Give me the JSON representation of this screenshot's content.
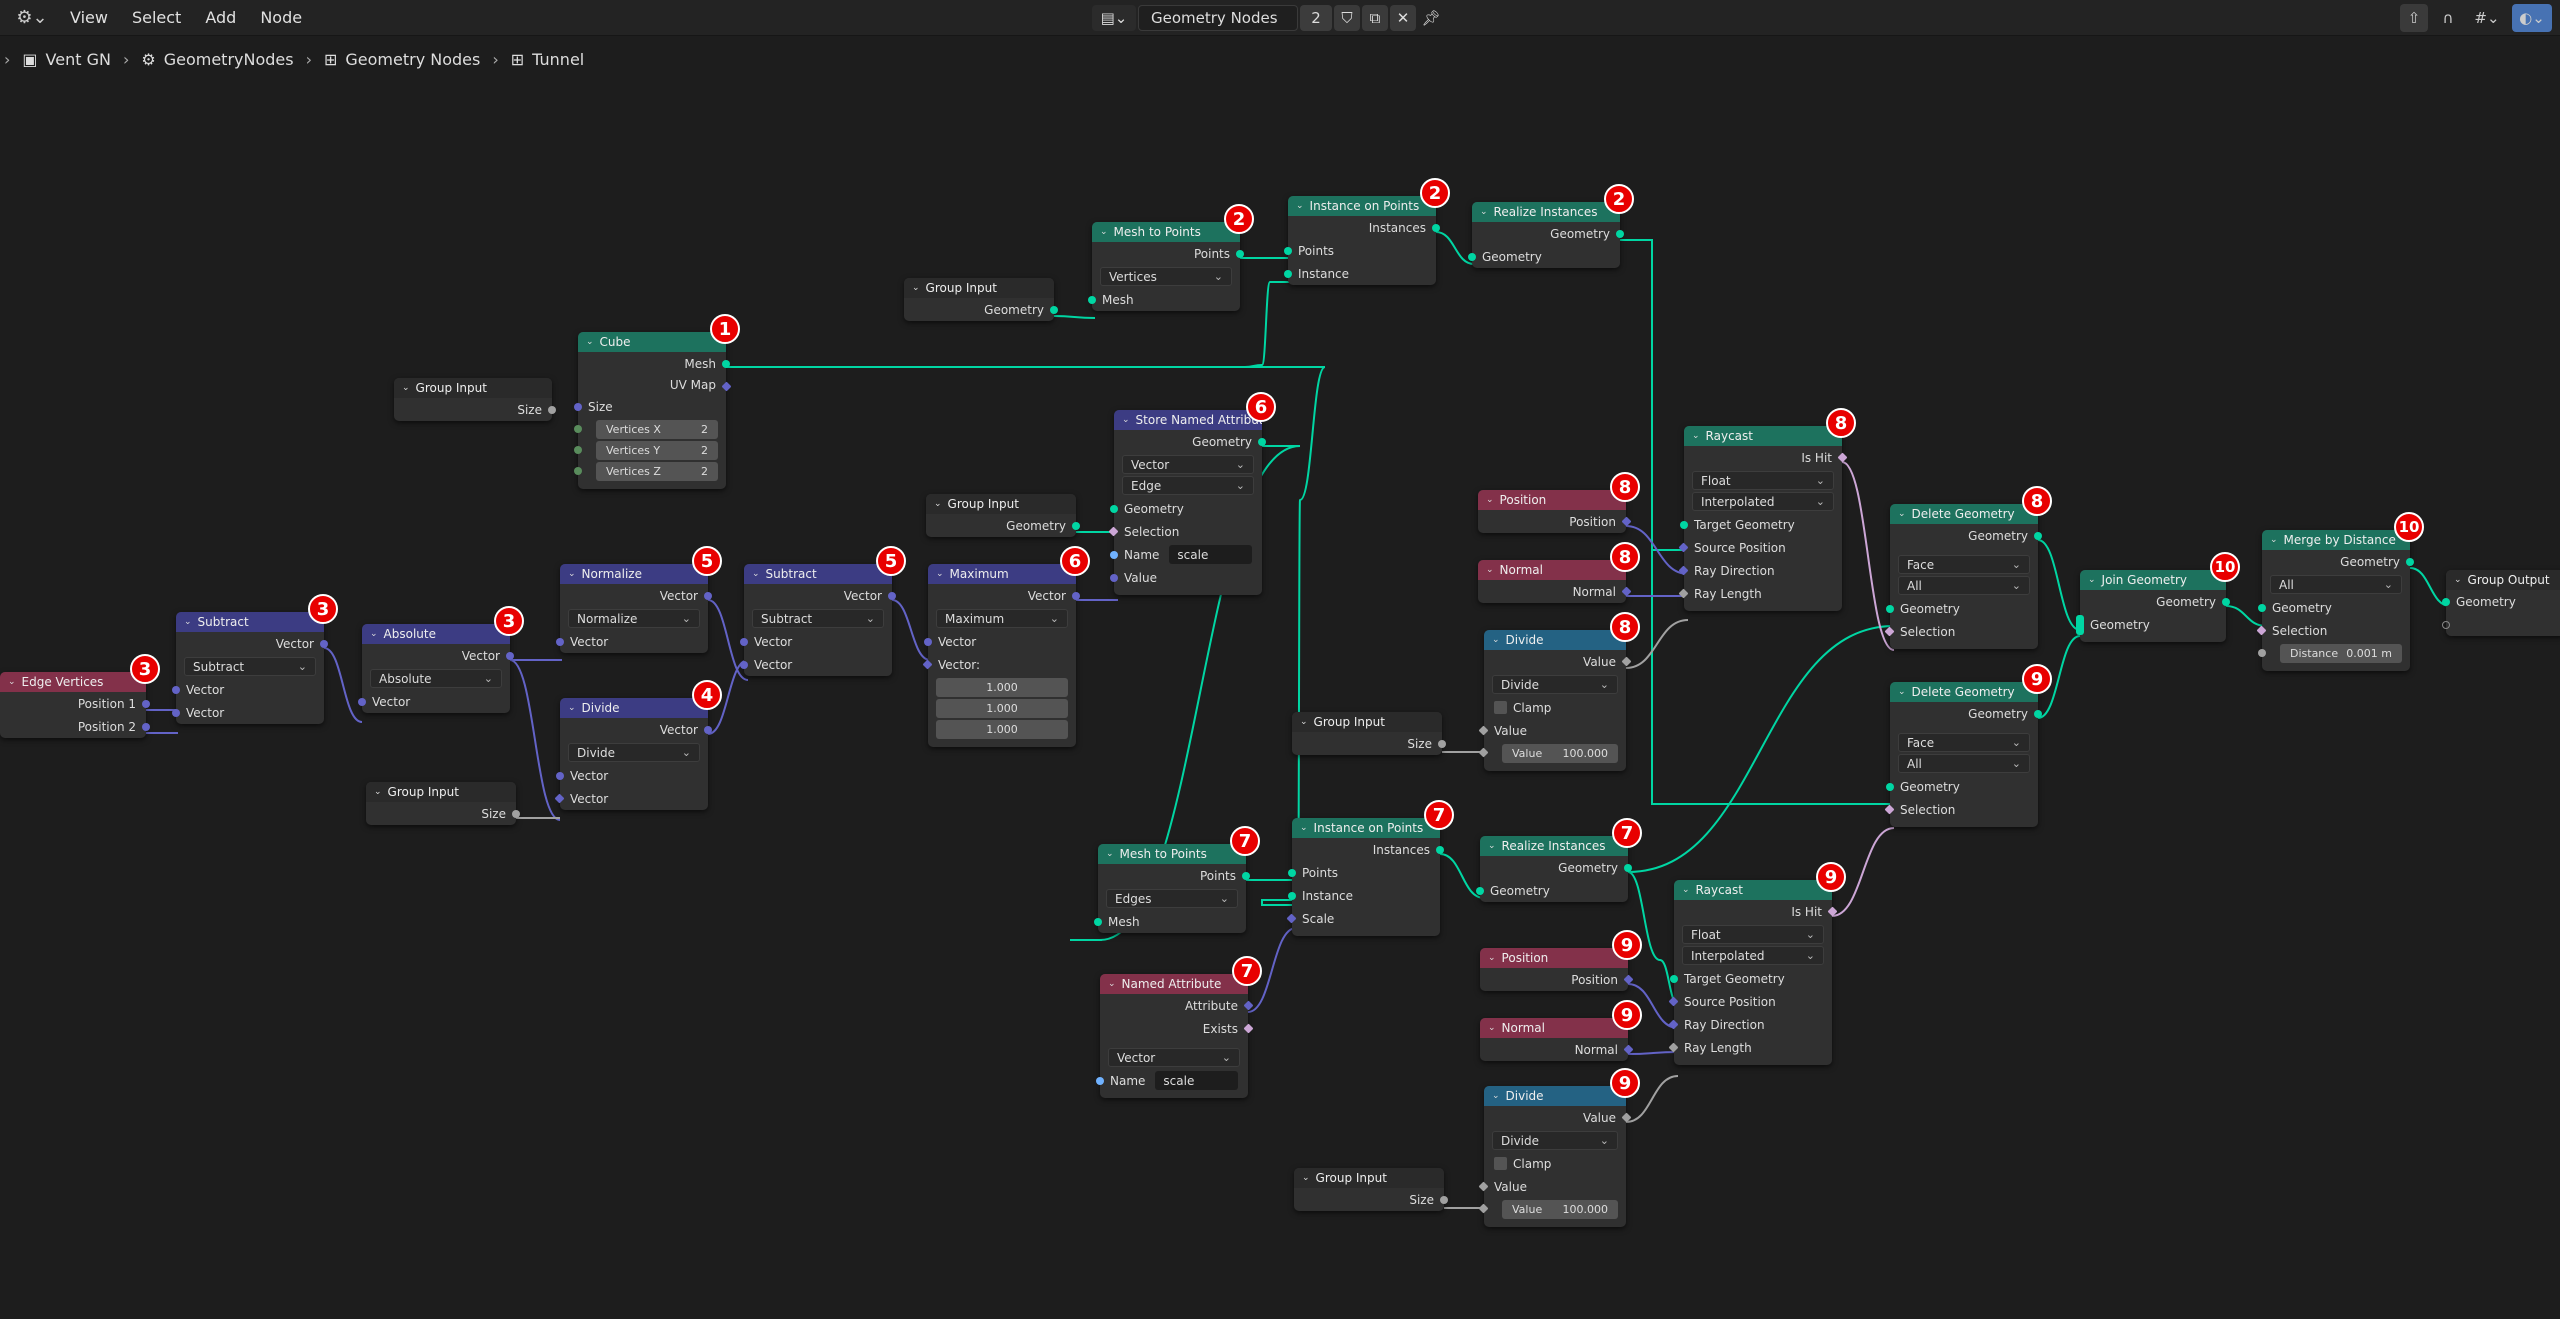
{
  "topbar": {
    "editor_icon": "node-editor-icon",
    "menus": [
      "View",
      "Select",
      "Add",
      "Node"
    ],
    "node_tree": {
      "name": "Geometry Nodes",
      "users": "2"
    },
    "icons": [
      "fake-user-shield-icon",
      "duplicate-icon",
      "close-icon",
      "pin-icon"
    ],
    "right_icons": [
      "parent-node-tree-icon",
      "snap-icon",
      "overlay-icon",
      "backdrop-icon"
    ]
  },
  "breadcrumbs": [
    "Vent GN",
    "GeometryNodes",
    "Geometry Nodes",
    "Tunnel"
  ],
  "nodes": {
    "gi_cube": {
      "title": "Group Input",
      "out": "Size"
    },
    "cube": {
      "title": "Cube",
      "badge": "1",
      "out_mesh": "Mesh",
      "out_uv": "UV Map",
      "in_size": "Size",
      "vx_label": "Vertices X",
      "vx": "2",
      "vy_label": "Vertices Y",
      "vy": "2",
      "vz_label": "Vertices Z",
      "vz": "2"
    },
    "gi_mtp1": {
      "title": "Group Input",
      "out": "Geometry"
    },
    "mtp1": {
      "title": "Mesh to Points",
      "badge": "2",
      "out": "Points",
      "mode": "Vertices",
      "in": "Mesh"
    },
    "iop1": {
      "title": "Instance on Points",
      "badge": "2",
      "out": "Instances",
      "in_points": "Points",
      "in_instance": "Instance"
    },
    "ri1": {
      "title": "Realize Instances",
      "badge": "2",
      "out": "Geometry",
      "in": "Geometry"
    },
    "edge_vertices": {
      "title": "Edge Vertices",
      "badge": "3",
      "out1": "Position 1",
      "out2": "Position 2"
    },
    "subtract1": {
      "title": "Subtract",
      "badge": "3",
      "out": "Vector",
      "op": "Subtract",
      "in1": "Vector",
      "in2": "Vector"
    },
    "absolute": {
      "title": "Absolute",
      "badge": "3",
      "out": "Vector",
      "op": "Absolute",
      "in": "Vector"
    },
    "normalize": {
      "title": "Normalize",
      "badge": "5",
      "out": "Vector",
      "op": "Normalize",
      "in": "Vector"
    },
    "divide_vec": {
      "title": "Divide",
      "badge": "4",
      "out": "Vector",
      "op": "Divide",
      "in1": "Vector",
      "in2": "Vector"
    },
    "gi_div": {
      "title": "Group Input",
      "out": "Size"
    },
    "subtract2": {
      "title": "Subtract",
      "badge": "5",
      "out": "Vector",
      "op": "Subtract",
      "in1": "Vector",
      "in2": "Vector"
    },
    "maximum": {
      "title": "Maximum",
      "badge": "6",
      "out": "Vector",
      "op": "Maximum",
      "in1": "Vector",
      "in2_label": "Vector:",
      "x": "1.000",
      "y": "1.000",
      "z": "1.000"
    },
    "gi_store": {
      "title": "Group Input",
      "out": "Geometry"
    },
    "store": {
      "title": "Store Named Attribute",
      "badge": "6",
      "out": "Geometry",
      "type": "Vector",
      "domain": "Edge",
      "in_geo": "Geometry",
      "in_sel": "Selection",
      "name_label": "Name",
      "name": "scale",
      "in_val": "Value"
    },
    "mtp2": {
      "title": "Mesh to Points",
      "badge": "7",
      "out": "Points",
      "mode": "Edges",
      "in": "Mesh"
    },
    "named_attr": {
      "title": "Named Attribute",
      "badge": "7",
      "out_attr": "Attribute",
      "out_exists": "Exists",
      "type": "Vector",
      "name_label": "Name",
      "name": "scale"
    },
    "iop2": {
      "title": "Instance on Points",
      "badge": "7",
      "out": "Instances",
      "in_points": "Points",
      "in_instance": "Instance",
      "in_scale": "Scale"
    },
    "ri2": {
      "title": "Realize Instances",
      "badge": "7",
      "out": "Geometry",
      "in": "Geometry"
    },
    "pos8": {
      "title": "Position",
      "badge": "8",
      "out": "Position"
    },
    "norm8": {
      "title": "Normal",
      "badge": "8",
      "out": "Normal"
    },
    "div8": {
      "title": "Divide",
      "badge": "8",
      "out": "Value",
      "op": "Divide",
      "clamp": "Clamp",
      "in": "Value",
      "val_label": "Value",
      "val": "100.000"
    },
    "gi8": {
      "title": "Group Input",
      "out": "Size"
    },
    "raycast8": {
      "title": "Raycast",
      "badge": "8",
      "out": "Is Hit",
      "type": "Float",
      "mapping": "Interpolated",
      "in1": "Target Geometry",
      "in2": "Source Position",
      "in3": "Ray Direction",
      "in4": "Ray Length"
    },
    "del8": {
      "title": "Delete Geometry",
      "badge": "8",
      "out": "Geometry",
      "domain": "Face",
      "mode": "All",
      "in_geo": "Geometry",
      "in_sel": "Selection"
    },
    "del9": {
      "title": "Delete Geometry",
      "badge": "9",
      "out": "Geometry",
      "domain": "Face",
      "mode": "All",
      "in_geo": "Geometry",
      "in_sel": "Selection"
    },
    "pos9": {
      "title": "Position",
      "badge": "9",
      "out": "Position"
    },
    "norm9": {
      "title": "Normal",
      "badge": "9",
      "out": "Normal"
    },
    "div9": {
      "title": "Divide",
      "badge": "9",
      "out": "Value",
      "op": "Divide",
      "clamp": "Clamp",
      "in": "Value",
      "val_label": "Value",
      "val": "100.000"
    },
    "gi9": {
      "title": "Group Input",
      "out": "Size"
    },
    "raycast9": {
      "title": "Raycast",
      "badge": "9",
      "out": "Is Hit",
      "type": "Float",
      "mapping": "Interpolated",
      "in1": "Target Geometry",
      "in2": "Source Position",
      "in3": "Ray Direction",
      "in4": "Ray Length"
    },
    "join": {
      "title": "Join Geometry",
      "badge": "10",
      "out": "Geometry",
      "in": "Geometry"
    },
    "merge": {
      "title": "Merge by Distance",
      "badge": "10",
      "out": "Geometry",
      "mode": "All",
      "in_geo": "Geometry",
      "in_sel": "Selection",
      "dist_label": "Distance",
      "dist": "0.001 m"
    },
    "group_output": {
      "title": "Group Output",
      "in": "Geometry"
    }
  },
  "colors": {
    "geometry_wire": "#00d6a3",
    "vector_wire": "#6363c7",
    "float_wire": "#a1a1a1",
    "bool_wire": "#cca6d6",
    "badge": "#e80000"
  }
}
